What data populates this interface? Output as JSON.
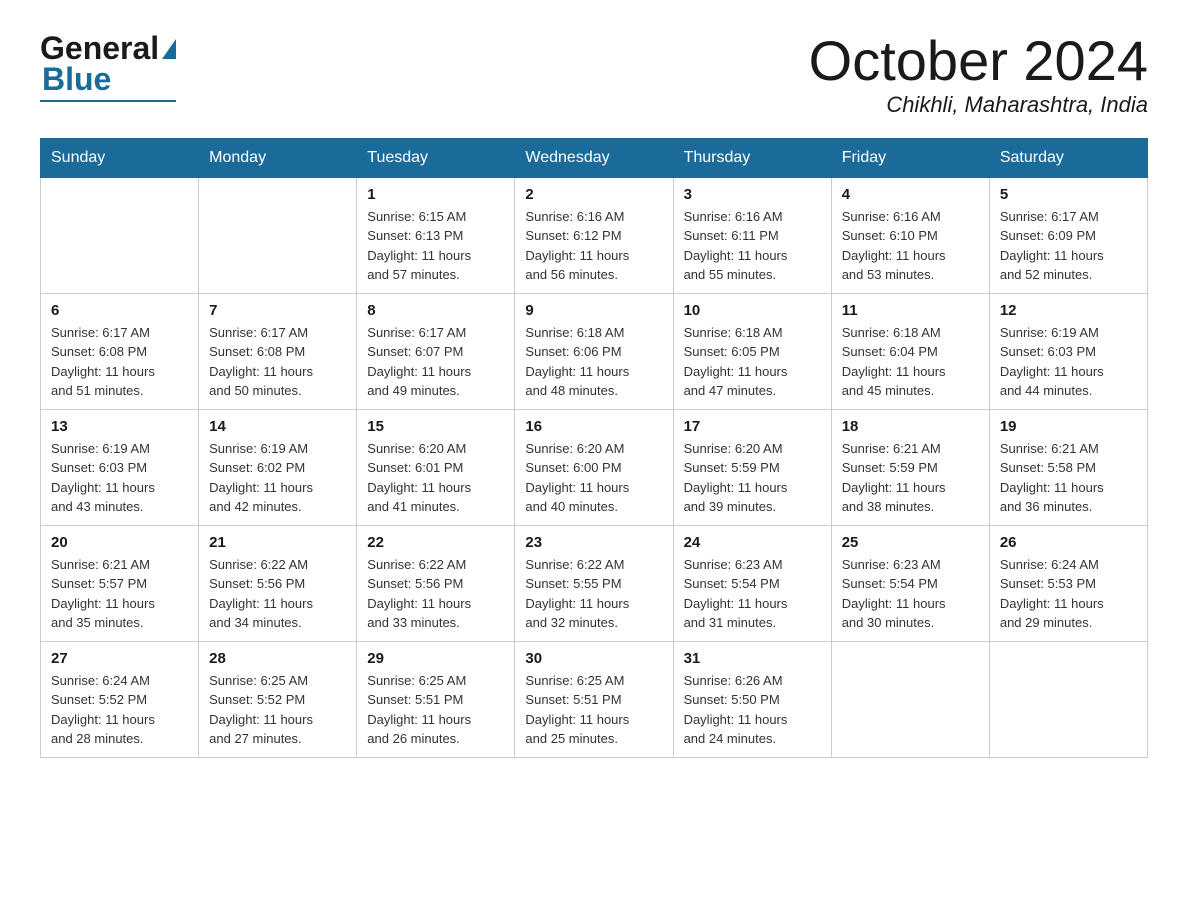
{
  "header": {
    "logo_general": "General",
    "logo_blue": "Blue",
    "month_year": "October 2024",
    "location": "Chikhli, Maharashtra, India"
  },
  "days_of_week": [
    "Sunday",
    "Monday",
    "Tuesday",
    "Wednesday",
    "Thursday",
    "Friday",
    "Saturday"
  ],
  "weeks": [
    [
      {
        "day": "",
        "info": ""
      },
      {
        "day": "",
        "info": ""
      },
      {
        "day": "1",
        "info": "Sunrise: 6:15 AM\nSunset: 6:13 PM\nDaylight: 11 hours\nand 57 minutes."
      },
      {
        "day": "2",
        "info": "Sunrise: 6:16 AM\nSunset: 6:12 PM\nDaylight: 11 hours\nand 56 minutes."
      },
      {
        "day": "3",
        "info": "Sunrise: 6:16 AM\nSunset: 6:11 PM\nDaylight: 11 hours\nand 55 minutes."
      },
      {
        "day": "4",
        "info": "Sunrise: 6:16 AM\nSunset: 6:10 PM\nDaylight: 11 hours\nand 53 minutes."
      },
      {
        "day": "5",
        "info": "Sunrise: 6:17 AM\nSunset: 6:09 PM\nDaylight: 11 hours\nand 52 minutes."
      }
    ],
    [
      {
        "day": "6",
        "info": "Sunrise: 6:17 AM\nSunset: 6:08 PM\nDaylight: 11 hours\nand 51 minutes."
      },
      {
        "day": "7",
        "info": "Sunrise: 6:17 AM\nSunset: 6:08 PM\nDaylight: 11 hours\nand 50 minutes."
      },
      {
        "day": "8",
        "info": "Sunrise: 6:17 AM\nSunset: 6:07 PM\nDaylight: 11 hours\nand 49 minutes."
      },
      {
        "day": "9",
        "info": "Sunrise: 6:18 AM\nSunset: 6:06 PM\nDaylight: 11 hours\nand 48 minutes."
      },
      {
        "day": "10",
        "info": "Sunrise: 6:18 AM\nSunset: 6:05 PM\nDaylight: 11 hours\nand 47 minutes."
      },
      {
        "day": "11",
        "info": "Sunrise: 6:18 AM\nSunset: 6:04 PM\nDaylight: 11 hours\nand 45 minutes."
      },
      {
        "day": "12",
        "info": "Sunrise: 6:19 AM\nSunset: 6:03 PM\nDaylight: 11 hours\nand 44 minutes."
      }
    ],
    [
      {
        "day": "13",
        "info": "Sunrise: 6:19 AM\nSunset: 6:03 PM\nDaylight: 11 hours\nand 43 minutes."
      },
      {
        "day": "14",
        "info": "Sunrise: 6:19 AM\nSunset: 6:02 PM\nDaylight: 11 hours\nand 42 minutes."
      },
      {
        "day": "15",
        "info": "Sunrise: 6:20 AM\nSunset: 6:01 PM\nDaylight: 11 hours\nand 41 minutes."
      },
      {
        "day": "16",
        "info": "Sunrise: 6:20 AM\nSunset: 6:00 PM\nDaylight: 11 hours\nand 40 minutes."
      },
      {
        "day": "17",
        "info": "Sunrise: 6:20 AM\nSunset: 5:59 PM\nDaylight: 11 hours\nand 39 minutes."
      },
      {
        "day": "18",
        "info": "Sunrise: 6:21 AM\nSunset: 5:59 PM\nDaylight: 11 hours\nand 38 minutes."
      },
      {
        "day": "19",
        "info": "Sunrise: 6:21 AM\nSunset: 5:58 PM\nDaylight: 11 hours\nand 36 minutes."
      }
    ],
    [
      {
        "day": "20",
        "info": "Sunrise: 6:21 AM\nSunset: 5:57 PM\nDaylight: 11 hours\nand 35 minutes."
      },
      {
        "day": "21",
        "info": "Sunrise: 6:22 AM\nSunset: 5:56 PM\nDaylight: 11 hours\nand 34 minutes."
      },
      {
        "day": "22",
        "info": "Sunrise: 6:22 AM\nSunset: 5:56 PM\nDaylight: 11 hours\nand 33 minutes."
      },
      {
        "day": "23",
        "info": "Sunrise: 6:22 AM\nSunset: 5:55 PM\nDaylight: 11 hours\nand 32 minutes."
      },
      {
        "day": "24",
        "info": "Sunrise: 6:23 AM\nSunset: 5:54 PM\nDaylight: 11 hours\nand 31 minutes."
      },
      {
        "day": "25",
        "info": "Sunrise: 6:23 AM\nSunset: 5:54 PM\nDaylight: 11 hours\nand 30 minutes."
      },
      {
        "day": "26",
        "info": "Sunrise: 6:24 AM\nSunset: 5:53 PM\nDaylight: 11 hours\nand 29 minutes."
      }
    ],
    [
      {
        "day": "27",
        "info": "Sunrise: 6:24 AM\nSunset: 5:52 PM\nDaylight: 11 hours\nand 28 minutes."
      },
      {
        "day": "28",
        "info": "Sunrise: 6:25 AM\nSunset: 5:52 PM\nDaylight: 11 hours\nand 27 minutes."
      },
      {
        "day": "29",
        "info": "Sunrise: 6:25 AM\nSunset: 5:51 PM\nDaylight: 11 hours\nand 26 minutes."
      },
      {
        "day": "30",
        "info": "Sunrise: 6:25 AM\nSunset: 5:51 PM\nDaylight: 11 hours\nand 25 minutes."
      },
      {
        "day": "31",
        "info": "Sunrise: 6:26 AM\nSunset: 5:50 PM\nDaylight: 11 hours\nand 24 minutes."
      },
      {
        "day": "",
        "info": ""
      },
      {
        "day": "",
        "info": ""
      }
    ]
  ]
}
